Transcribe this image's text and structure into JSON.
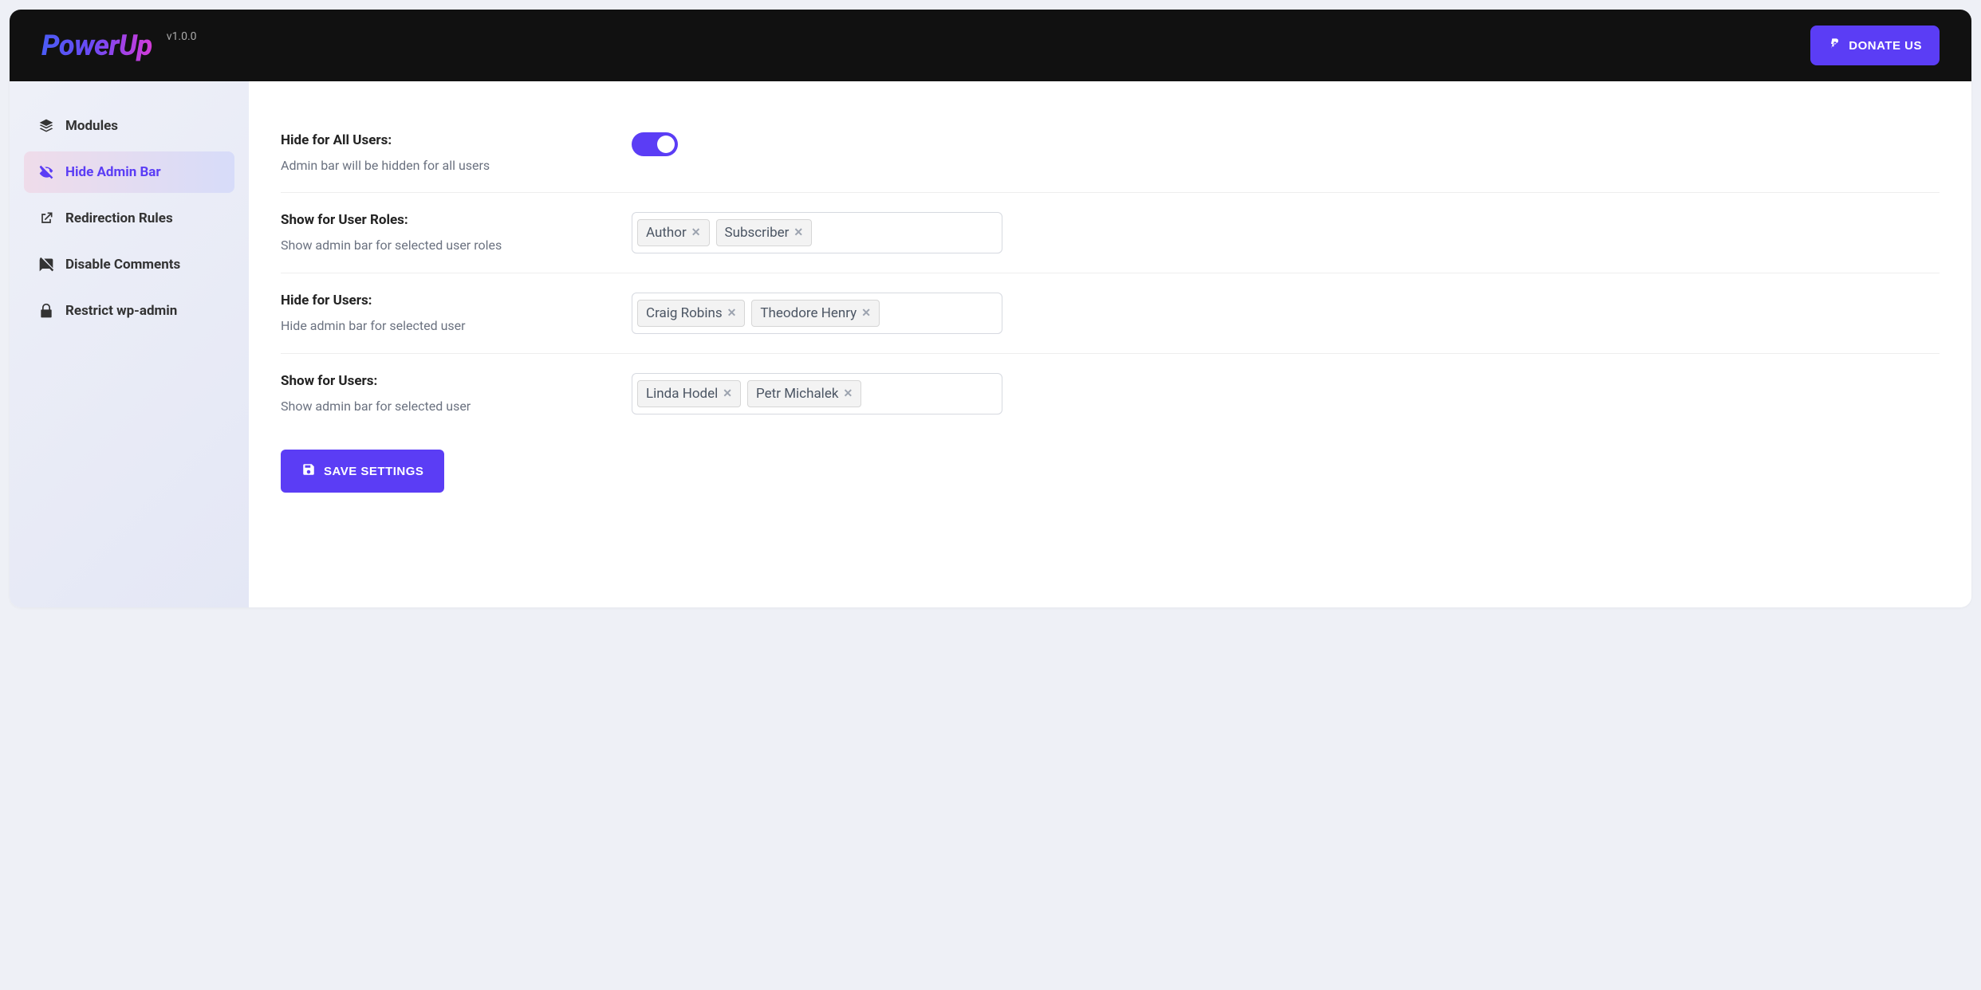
{
  "header": {
    "logo": "PowerUp",
    "version": "v1.0.0",
    "donate_label": "DONATE US"
  },
  "sidebar": {
    "items": [
      {
        "label": "Modules",
        "icon": "layers-icon",
        "active": false
      },
      {
        "label": "Hide Admin Bar",
        "icon": "eye-off-icon",
        "active": true
      },
      {
        "label": "Redirection Rules",
        "icon": "external-link-icon",
        "active": false
      },
      {
        "label": "Disable Comments",
        "icon": "comment-off-icon",
        "active": false
      },
      {
        "label": "Restrict wp-admin",
        "icon": "lock-icon",
        "active": false
      }
    ]
  },
  "settings": {
    "hide_all": {
      "title": "Hide for All Users:",
      "desc": "Admin bar will be hidden for all users",
      "value": true
    },
    "show_roles": {
      "title": "Show for User Roles:",
      "desc": "Show admin bar for selected user roles",
      "tags": [
        "Author",
        "Subscriber"
      ]
    },
    "hide_users": {
      "title": "Hide for Users:",
      "desc": "Hide admin bar for selected user",
      "tags": [
        "Craig Robins",
        "Theodore Henry"
      ]
    },
    "show_users": {
      "title": "Show for Users:",
      "desc": "Show admin bar for selected user",
      "tags": [
        "Linda Hodel",
        "Petr Michalek"
      ]
    }
  },
  "save_button": "SAVE SETTINGS",
  "colors": {
    "accent": "#5b3df5"
  }
}
